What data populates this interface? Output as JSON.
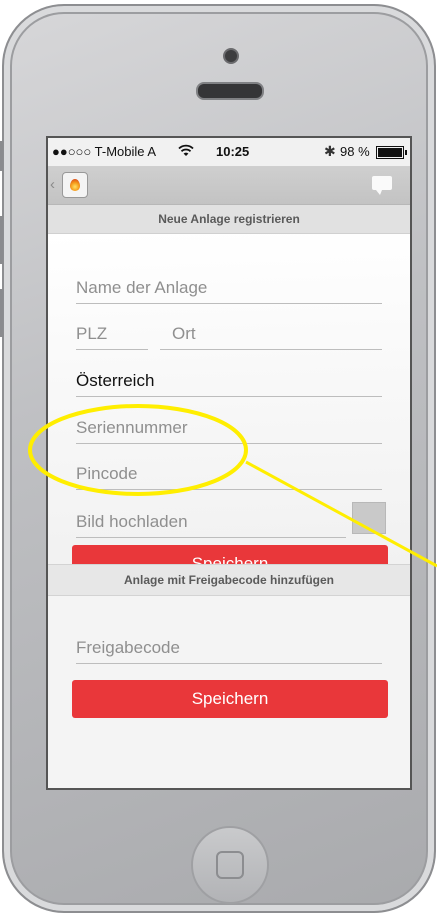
{
  "status": {
    "carrier": "●●○○○ T-Mobile A",
    "wifi_icon": "wifi-icon",
    "time": "10:25",
    "bluetooth": "✱",
    "battery": "98 %"
  },
  "navbar": {
    "back": "‹"
  },
  "register": {
    "header": "Neue Anlage registrieren",
    "name_placeholder": "Name der Anlage",
    "plz_placeholder": "PLZ",
    "ort_placeholder": "Ort",
    "country": "Österreich",
    "serial_placeholder": "Seriennummer",
    "pin_placeholder": "Pincode",
    "image_label": "Bild hochladen",
    "save_label": "Speichern"
  },
  "share": {
    "header": "Anlage mit Freigabecode hinzufügen",
    "code_placeholder": "Freigabecode",
    "save_label": "Speichern"
  },
  "colors": {
    "accent": "#e9373a",
    "highlight": "#ffee00"
  }
}
